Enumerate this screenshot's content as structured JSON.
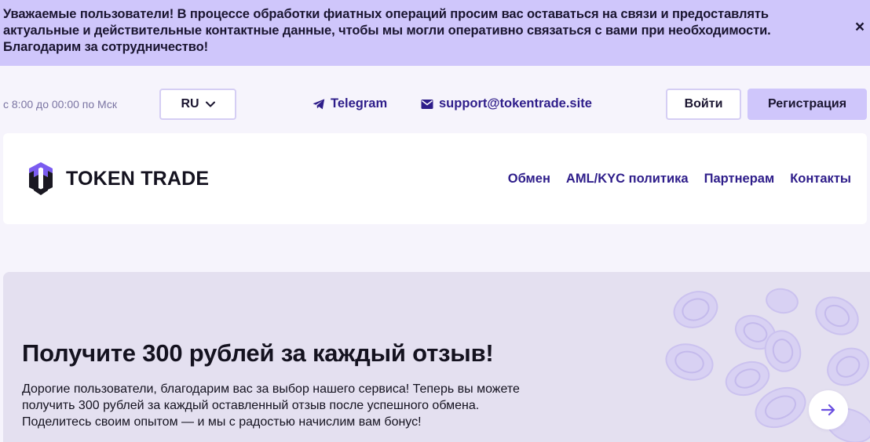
{
  "notice": {
    "text": "Уважаемые пользователи! В процессе обработки фиатных операций просим вас оставаться на связи и предоставлять актуальные и действительные контактные данные, чтобы мы могли оперативно связаться с вами при необходимости. Благодарим за сотрудничество!",
    "close_icon": "close-icon",
    "close_symbol": "×"
  },
  "topbar": {
    "hours": "с 8:00 до 00:00 по Мск",
    "language": "RU",
    "telegram": "Telegram",
    "email": "support@tokentrade.site",
    "login": "Войти",
    "register": "Регистрация"
  },
  "header": {
    "logo_text": "TOKEN TRADE",
    "nav": [
      {
        "label": "Обмен"
      },
      {
        "label": "AML/KYC политика"
      },
      {
        "label": "Партнерам"
      },
      {
        "label": "Контакты"
      }
    ]
  },
  "hero": {
    "title": "Получите 300 рублей за каждый отзыв!",
    "body": "Дорогие пользователи, благодарим вас за выбор нашего сервиса! Теперь вы можете получить 300 рублей за каждый оставленный отзыв после успешного обмена. Поделитесь своим опытом — и мы с радостью начислим вам бонус!",
    "arrow_icon": "arrow-right-icon"
  },
  "colors": {
    "accent": "#cfc6fb",
    "link": "#2e1d8a",
    "hero_bg": "#e4e0f0",
    "page_bg": "#f6f4fc"
  }
}
